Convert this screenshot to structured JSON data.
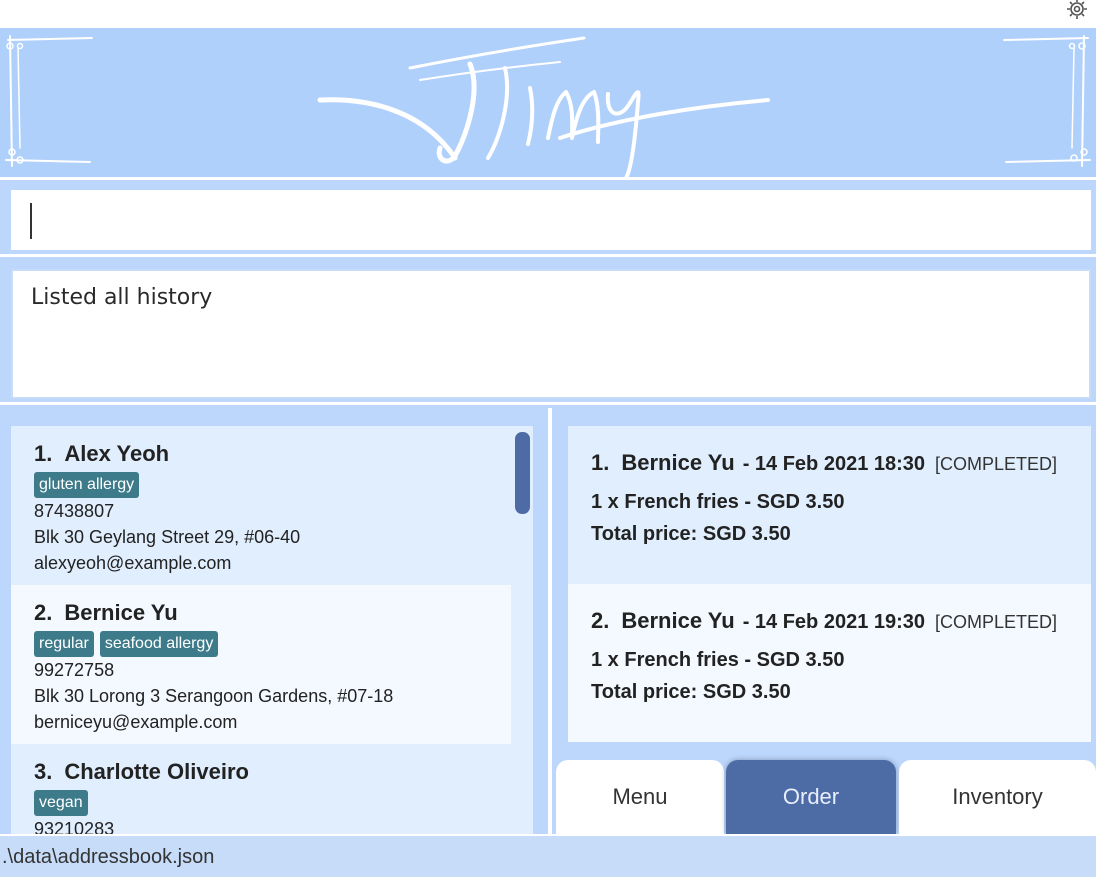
{
  "app": {
    "logo_text": "Jimy"
  },
  "command": {
    "value": "",
    "placeholder": ""
  },
  "result": {
    "message": "Listed all history"
  },
  "persons": [
    {
      "index": "1.",
      "name": "Alex Yeoh",
      "tags": [
        "gluten allergy"
      ],
      "phone": "87438807",
      "address": "Blk 30 Geylang Street 29, #06-40",
      "email": "alexyeoh@example.com"
    },
    {
      "index": "2.",
      "name": "Bernice Yu",
      "tags": [
        "regular",
        "seafood allergy"
      ],
      "phone": "99272758",
      "address": "Blk 30 Lorong 3 Serangoon Gardens, #07-18",
      "email": "berniceyu@example.com"
    },
    {
      "index": "3.",
      "name": "Charlotte Oliveiro",
      "tags": [
        "vegan"
      ],
      "phone": "93210283",
      "address": "",
      "email": ""
    }
  ],
  "orders": [
    {
      "index": "1.",
      "customer": "Bernice Yu",
      "date": "- 14 Feb 2021 18:30",
      "status": "[COMPLETED]",
      "item": "1 x French fries - SGD 3.50",
      "total": "Total price: SGD 3.50"
    },
    {
      "index": "2.",
      "customer": "Bernice Yu",
      "date": "- 14 Feb 2021 19:30",
      "status": "[COMPLETED]",
      "item": "1 x French fries - SGD 3.50",
      "total": "Total price: SGD 3.50"
    }
  ],
  "tabs": [
    {
      "label": "Menu",
      "active": false
    },
    {
      "label": "Order",
      "active": true
    },
    {
      "label": "Inventory",
      "active": false
    }
  ],
  "status_bar": {
    "path": ".\\data\\addressbook.json"
  },
  "colors": {
    "accent": "#4d6ca6",
    "tag": "#3d7b8a",
    "background": "#bcd6fc",
    "card": "#e0eefe"
  },
  "icons": {
    "settings": "gear-icon"
  }
}
